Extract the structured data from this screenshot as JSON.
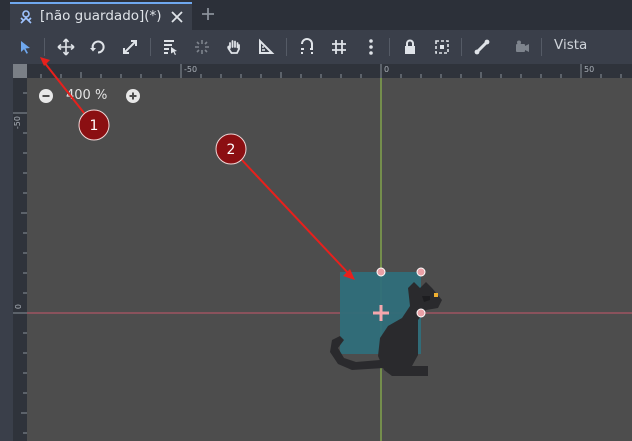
{
  "tab": {
    "title": "[não guardado](*)",
    "icon": "scene-node-icon",
    "close_icon": "close-icon",
    "add_icon": "plus-icon"
  },
  "toolbar": {
    "tools": [
      "select-arrow-icon",
      "move-icon",
      "rotate-icon",
      "scale-icon",
      "list-select-icon",
      "pivot-icon",
      "pan-hand-icon",
      "ruler-icon",
      "snap-smart-icon",
      "snap-grid-icon",
      "more-options-icon",
      "lock-icon",
      "group-icon",
      "skeleton-bone-icon",
      "camera-icon"
    ],
    "view_label": "Vista"
  },
  "rulers": {
    "h_ticks": [
      "-50",
      "0",
      "50"
    ],
    "v_ticks": [
      "-50",
      "0"
    ]
  },
  "zoom": {
    "label": "400 %",
    "zoom_out_icon": "zoom-out-icon",
    "zoom_in_icon": "zoom-in-icon"
  },
  "annotations": [
    "1",
    "2"
  ],
  "colors": {
    "background": "#4d4d4d",
    "toolbar": "#3a3f4a",
    "tabbar": "#2c3039",
    "accent": "#6fa8ef",
    "selection": "#2f6e7a",
    "marker": "#8b0f12",
    "arrow": "#e8201c",
    "x_axis": "#c8566a",
    "y_axis": "#9bcf4a"
  }
}
